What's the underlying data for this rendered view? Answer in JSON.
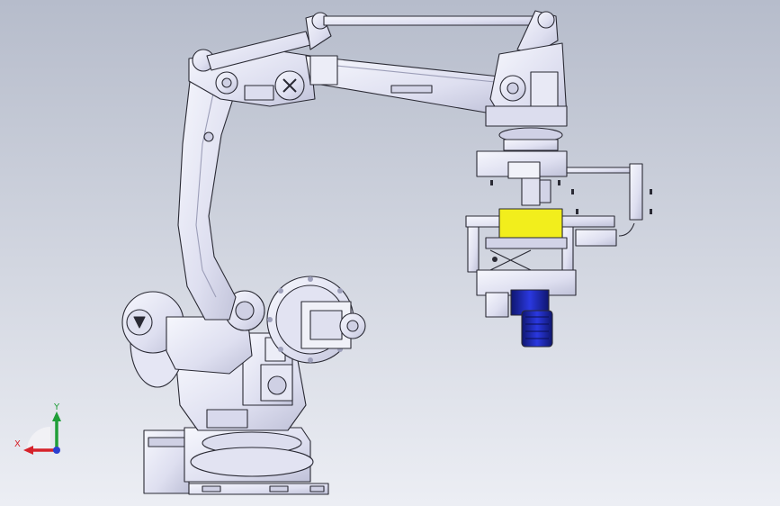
{
  "viewport": {
    "background_top": "#b6bccb",
    "background_bottom": "#eceef4"
  },
  "colors": {
    "body_fill": "#e9eaf5",
    "body_shade": "#c9cbe0",
    "outline": "#2a2a34",
    "gripper_yellow": "#f2ee1c",
    "motor_blue": "#1e2ac8",
    "motor_dark": "#0f166e",
    "axis_x": "#d6222a",
    "axis_y": "#1f9e38",
    "axis_z": "#2a3fd0"
  },
  "triad": {
    "x_label": "X",
    "y_label": "Y",
    "x_icon": "x-axis-arrow-icon",
    "y_icon": "y-axis-arrow-icon",
    "z_icon": "z-axis-point-icon"
  }
}
